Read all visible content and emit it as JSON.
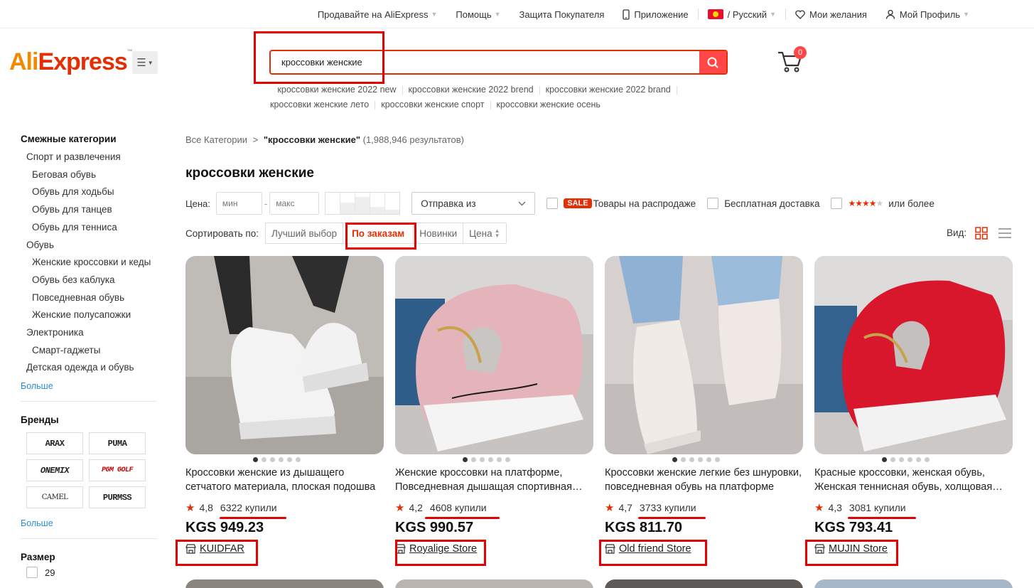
{
  "topnav": {
    "sell": "Продавайте на AliExpress",
    "help": "Помощь",
    "buyer_protection": "Защита Покупателя",
    "app": "Приложение",
    "language": "/ Русский",
    "wishlist": "Мои желания",
    "profile": "Мой Профиль"
  },
  "logo": {
    "part1": "Ali",
    "part2": "Express",
    "tm": "™"
  },
  "search": {
    "value": "кроссовки женские",
    "suggestions": [
      "кроссовки женские 2022 new",
      "кроссовки женские 2022 brend",
      "кроссовки женские 2022 brand",
      "кроссовки женские лето",
      "кроссовки женские спорт",
      "кроссовки женские осень"
    ]
  },
  "cart": {
    "count": "0"
  },
  "sidebar": {
    "categories_title": "Смежные категории",
    "categories": [
      {
        "label": "Спорт и развлечения",
        "level": 1
      },
      {
        "label": "Беговая обувь",
        "level": 2
      },
      {
        "label": "Обувь для ходьбы",
        "level": 2
      },
      {
        "label": "Обувь для танцев",
        "level": 2
      },
      {
        "label": "Обувь для тенниса",
        "level": 2
      },
      {
        "label": "Обувь",
        "level": 1
      },
      {
        "label": "Женские кроссовки и кеды",
        "level": 2
      },
      {
        "label": "Обувь без каблука",
        "level": 2
      },
      {
        "label": "Повседневная обувь",
        "level": 2
      },
      {
        "label": "Женские полусапожки",
        "level": 2
      },
      {
        "label": "Электроника",
        "level": 1
      },
      {
        "label": "Смарт-гаджеты",
        "level": 2
      },
      {
        "label": "Детская одежда и обувь",
        "level": 1
      }
    ],
    "more": "Больше",
    "brands_title": "Бренды",
    "brands": [
      "ARAX",
      "PUMA",
      "ONEMIX",
      "PGM GOLF",
      "CAMEL",
      "PURMSS"
    ],
    "size_title": "Размер",
    "size_first": "29"
  },
  "main": {
    "breadcrumb_root": "Все Категории",
    "breadcrumb_sep": ">",
    "breadcrumb_query": "\"кроссовки женские\"",
    "breadcrumb_count": "(1,988,946 результатов)",
    "title": "кроссовки женские",
    "price_label": "Цена:",
    "price_min_placeholder": "мин",
    "price_max_placeholder": "макс",
    "price_dash": "-",
    "ship_from": "Отправка из",
    "sale_badge": "SALE",
    "sale_label": "Товары на распродаже",
    "free_shipping": "Бесплатная доставка",
    "rating_label": "или более",
    "sort_label": "Сортировать по:",
    "sort_options": [
      "Лучший выбор",
      "По заказам",
      "Новинки",
      "Цена"
    ],
    "sort_active": "По заказам",
    "view_label": "Вид:"
  },
  "products": [
    {
      "title": "Кроссовки женские из дышащего сетчатого материала, плоская подошва",
      "rating": "4,8",
      "sold": "6322 купили",
      "price": "KGS 949.23",
      "store": "KUIDFAR"
    },
    {
      "title": "Женские кроссовки на платформе, Повседневная дышащая спортивная обувь",
      "rating": "4,2",
      "sold": "4608 купили",
      "price": "KGS 990.57",
      "store": "Royalige Store"
    },
    {
      "title": "Кроссовки женские легкие без шнуровки, повседневная обувь на платформе",
      "rating": "4,7",
      "sold": "3733 купили",
      "price": "KGS 811.70",
      "store": "Old friend Store"
    },
    {
      "title": "Красные кроссовки, женская обувь, Женская теннисная обувь, холщовая обувь",
      "rating": "4,3",
      "sold": "3081 купили",
      "price": "KGS 793.41",
      "store": "MUJIN Store"
    }
  ],
  "colors": {
    "accent": "#e62e04",
    "search_button": "#ff4747",
    "annotation_red": "#e60000",
    "link_blue": "#2b8cd3"
  }
}
